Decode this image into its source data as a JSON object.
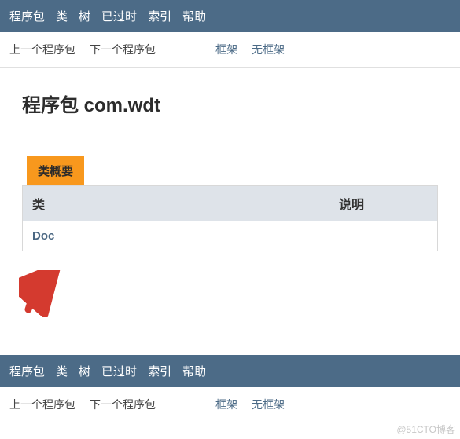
{
  "nav": {
    "items": [
      "程序包",
      "类",
      "树",
      "已过时",
      "索引",
      "帮助"
    ]
  },
  "subnav": {
    "prev": "上一个程序包",
    "next": "下一个程序包",
    "frames": "框架",
    "noframes": "无框架"
  },
  "package": {
    "title_prefix": "程序包 ",
    "name": "com.wdt"
  },
  "class_summary": {
    "tab_label": "类概要",
    "col_class_header": "类",
    "col_desc_header": "说明",
    "rows": [
      {
        "name": "Doc",
        "description": ""
      }
    ]
  },
  "watermark": "@51CTO博客"
}
